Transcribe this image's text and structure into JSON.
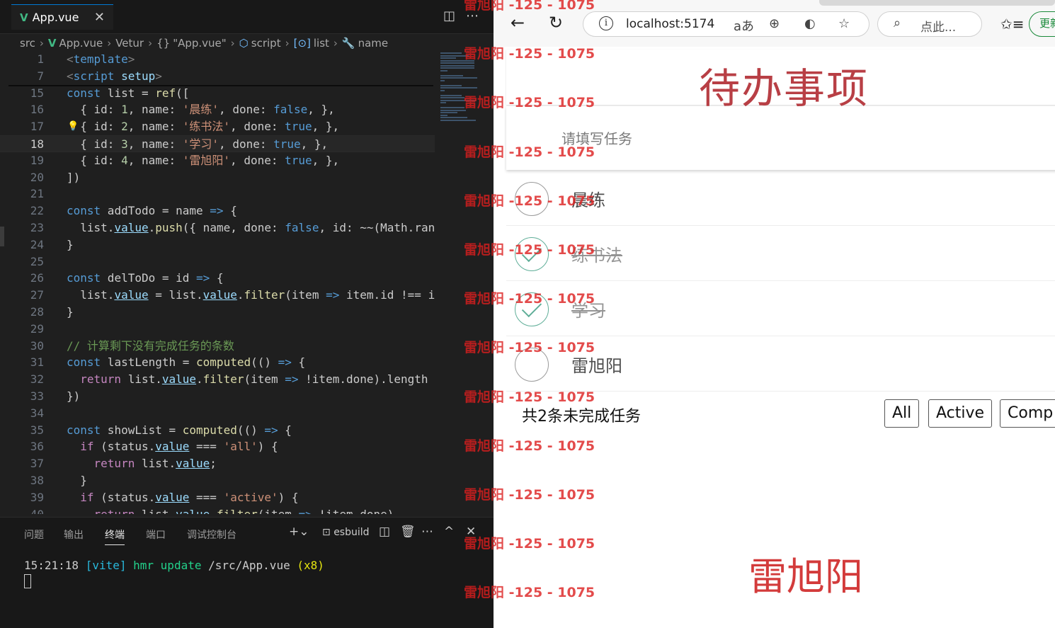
{
  "editor": {
    "tab_title": "App.vue",
    "tab_icon": "V",
    "close": "✕",
    "breadcrumb": [
      "src",
      "App.vue",
      "Vetur",
      "\"App.vue\"",
      "script",
      "list",
      "name"
    ]
  },
  "code_lines": [
    {
      "n": "1",
      "text": "<template>"
    },
    {
      "n": "7",
      "text": "<script setup>"
    },
    {
      "n": "15",
      "text": "const list = ref(["
    },
    {
      "n": "16",
      "text": "  { id: 1, name: '晨练', done: false, },"
    },
    {
      "n": "17",
      "text": "  { id: 2, name: '练书法', done: true, },"
    },
    {
      "n": "18",
      "text": "  { id: 3, name: '学习', done: true, },"
    },
    {
      "n": "19",
      "text": "  { id: 4, name: '雷旭阳', done: true, },"
    },
    {
      "n": "20",
      "text": "])"
    },
    {
      "n": "21",
      "text": ""
    },
    {
      "n": "22",
      "text": "const addTodo = name => {"
    },
    {
      "n": "23",
      "text": "  list.value.push({ name, done: false, id: ~~(Math.ran"
    },
    {
      "n": "24",
      "text": "}"
    },
    {
      "n": "25",
      "text": ""
    },
    {
      "n": "26",
      "text": "const delToDo = id => {"
    },
    {
      "n": "27",
      "text": "  list.value = list.value.filter(item => item.id !== i"
    },
    {
      "n": "28",
      "text": "}"
    },
    {
      "n": "29",
      "text": ""
    },
    {
      "n": "30",
      "text": "// 计算剩下没有完成任务的条数"
    },
    {
      "n": "31",
      "text": "const lastLength = computed(() => {"
    },
    {
      "n": "32",
      "text": "  return list.value.filter(item => !item.done).length"
    },
    {
      "n": "33",
      "text": "})"
    },
    {
      "n": "34",
      "text": ""
    },
    {
      "n": "35",
      "text": "const showList = computed(() => {"
    },
    {
      "n": "36",
      "text": "  if (status.value === 'all') {"
    },
    {
      "n": "37",
      "text": "    return list.value;"
    },
    {
      "n": "38",
      "text": "  }"
    },
    {
      "n": "39",
      "text": "  if (status.value === 'active') {"
    },
    {
      "n": "40",
      "text": "    return list.value.filter(item => !item.done)"
    }
  ],
  "panel": {
    "tabs": [
      "问题",
      "输出",
      "终端",
      "端口",
      "调试控制台"
    ],
    "active_tab": "终端",
    "shell_label": "esbuild",
    "terminal": {
      "time": "15:21:18",
      "tag": "[vite]",
      "msg": "hmr update",
      "path": "/src/App.vue",
      "count": "(x8)"
    }
  },
  "browser": {
    "url": "localhost:5174",
    "search_placeholder": "点此...",
    "update_label": "更新"
  },
  "todo": {
    "title": "待办事项",
    "input_placeholder": "请填写任务",
    "items": [
      {
        "name": "晨练",
        "done": false
      },
      {
        "name": "练书法",
        "done": true
      },
      {
        "name": "学习",
        "done": true
      },
      {
        "name": "雷旭阳",
        "done": false
      }
    ],
    "remaining_text": "共2条未完成任务",
    "filters": [
      "All",
      "Active",
      "Comp"
    ],
    "signature": "雷旭阳"
  },
  "watermark": "雷旭阳 -125 - 1075",
  "colors": {
    "accent": "#b83f45",
    "check": "#5fae98",
    "watermark": "#dc1e1e"
  }
}
